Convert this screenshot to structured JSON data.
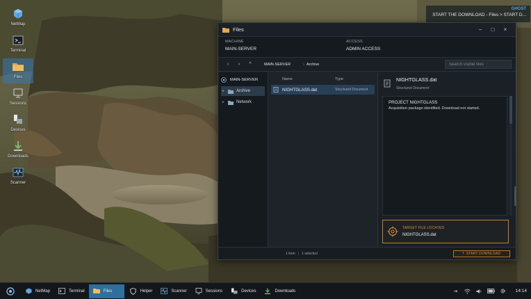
{
  "desktop": {
    "icons": [
      {
        "label": "NetMap",
        "icon": "cube-icon"
      },
      {
        "label": "Terminal",
        "icon": "terminal-icon"
      },
      {
        "label": "Files",
        "icon": "folder-icon"
      },
      {
        "label": "Sessions",
        "icon": "monitor-icon"
      },
      {
        "label": "Devices",
        "icon": "devices-icon"
      },
      {
        "label": "Downloads",
        "icon": "download-icon"
      },
      {
        "label": "Scanner",
        "icon": "waveform-icon"
      }
    ]
  },
  "notification": {
    "title": "GHOST",
    "message": "START THE DOWNLOAD - Files > START D..."
  },
  "window": {
    "title": "Files",
    "controls": {
      "minimize": "–",
      "maximize": "□",
      "close": "×"
    },
    "machine_label": "MACHINE",
    "machine_value": "MAIN-SERVER",
    "access_label": "ACCESS",
    "access_value": "ADMIN ACCESS",
    "nav": {
      "back": "‹",
      "forward": "›",
      "up": "^"
    },
    "breadcrumb_root": "MAIN-SERVER",
    "breadcrumb_sep": "›",
    "breadcrumb_current": "Archive",
    "search_placeholder": "Search visible files",
    "tree": {
      "root": "MAIN-SERVER",
      "items": [
        {
          "label": "Archive",
          "selected": true
        },
        {
          "label": "Network",
          "selected": false
        }
      ]
    },
    "file_list": {
      "col_name": "Name",
      "col_type": "Type",
      "rows": [
        {
          "name": "NIGHTGLASS.dat",
          "type": "Structured Document"
        }
      ]
    },
    "preview": {
      "filename": "NIGHTGLASS.dat",
      "subtitle": "Structured Document",
      "heading": "PROJECT NIGHTGLASS",
      "body": "Acquisition package identified. Download not started.",
      "target_label": "TARGET FILE LOCATED",
      "target_file": "NIGHTGLASS.dat"
    },
    "status": {
      "count": "1 item",
      "separator": "|",
      "selected": "1 selected",
      "download_button": "START DOWNLOAD"
    }
  },
  "taskbar": {
    "items": [
      {
        "label": "NetMap",
        "icon": "cube-icon",
        "active": false
      },
      {
        "label": "Terminal",
        "icon": "terminal-icon",
        "active": false
      },
      {
        "label": "Files",
        "icon": "folder-icon",
        "active": true
      },
      {
        "label": "Helper",
        "icon": "shield-icon",
        "active": false
      },
      {
        "label": "Scanner",
        "icon": "waveform-icon",
        "active": false
      },
      {
        "label": "Sessions",
        "icon": "monitor-icon",
        "active": false
      },
      {
        "label": "Devices",
        "icon": "devices-icon",
        "active": false
      },
      {
        "label": "Downloads",
        "icon": "download-icon",
        "active": false
      }
    ],
    "clock": "14:14"
  },
  "colors": {
    "accent": "#2f6f9e",
    "warning": "#d79236",
    "window_bg": "#1d2329"
  }
}
